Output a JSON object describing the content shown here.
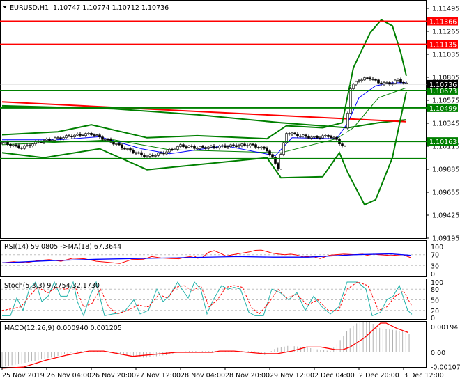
{
  "chart_data": [
    {
      "type": "candlestick",
      "title": "EURUSD,H1",
      "ohlc_text": "1.10747 1.10774 1.10712 1.10736",
      "ylim": [
        1.09195,
        1.11495
      ],
      "y_ticks": [
        "1.11495",
        "1.11265",
        "1.11035",
        "1.10805",
        "1.10575",
        "1.10345",
        "1.10115",
        "1.09885",
        "1.09655",
        "1.09425",
        "1.09195"
      ],
      "current_price": "1.10736",
      "levels": [
        {
          "value": 1.11366,
          "label": "1.11366",
          "color": "#ff0000"
        },
        {
          "value": 1.11135,
          "label": "1.11135",
          "color": "#ff0000"
        },
        {
          "value": 1.10673,
          "label": "1.10673",
          "color": "#008000"
        },
        {
          "value": 1.10499,
          "label": "1.10499",
          "color": "#008000"
        },
        {
          "value": 1.10163,
          "label": "1.10163",
          "color": "#008000"
        },
        {
          "value": 1.0999,
          "label": "",
          "color": "#008000"
        }
      ],
      "close": [
        [
          0,
          1.1015
        ],
        [
          7,
          1.101
        ],
        [
          13,
          1.1016
        ],
        [
          19,
          1.1019
        ],
        [
          25,
          1.1022
        ],
        [
          32,
          1.1024
        ],
        [
          39,
          1.1016
        ],
        [
          45,
          1.1008
        ],
        [
          52,
          1.1001
        ],
        [
          58,
          1.1005
        ],
        [
          64,
          1.1012
        ],
        [
          70,
          1.101
        ],
        [
          77,
          1.1011
        ],
        [
          83,
          1.1012
        ],
        [
          89,
          1.1013
        ],
        [
          95,
          1.1008
        ],
        [
          99,
          1.099
        ],
        [
          100,
          1.1003
        ],
        [
          102,
          1.1025
        ],
        [
          107,
          1.1022
        ],
        [
          112,
          1.102
        ],
        [
          117,
          1.1022
        ],
        [
          120,
          1.1018
        ],
        [
          122,
          1.1012
        ],
        [
          124,
          1.1045
        ],
        [
          125,
          1.107
        ],
        [
          128,
          1.1078
        ],
        [
          132,
          1.108
        ],
        [
          135,
          1.1075
        ],
        [
          139,
          1.1074
        ],
        [
          142,
          1.1078
        ],
        [
          145,
          1.10736
        ]
      ],
      "bb_upper": [
        [
          0,
          1.1023
        ],
        [
          20,
          1.1026
        ],
        [
          32,
          1.1033
        ],
        [
          52,
          1.102
        ],
        [
          70,
          1.1022
        ],
        [
          95,
          1.1019
        ],
        [
          102,
          1.1032
        ],
        [
          115,
          1.103
        ],
        [
          122,
          1.1035
        ],
        [
          126,
          1.109
        ],
        [
          132,
          1.1125
        ],
        [
          136,
          1.1138
        ],
        [
          140,
          1.1132
        ],
        [
          143,
          1.1105
        ],
        [
          145,
          1.1082
        ]
      ],
      "bb_lower": [
        [
          0,
          1.1005
        ],
        [
          15,
          1.1
        ],
        [
          35,
          1.1009
        ],
        [
          52,
          1.0988
        ],
        [
          70,
          1.0993
        ],
        [
          95,
          1.1
        ],
        [
          100,
          1.098
        ],
        [
          115,
          1.0981
        ],
        [
          121,
          1.1005
        ],
        [
          124,
          1.0985
        ],
        [
          130,
          1.0953
        ],
        [
          134,
          1.0958
        ],
        [
          140,
          1.1
        ],
        [
          143,
          1.104
        ],
        [
          145,
          1.1066
        ]
      ],
      "ma_long": [
        [
          0,
          1.1052
        ],
        [
          40,
          1.1049
        ],
        [
          70,
          1.1043
        ],
        [
          100,
          1.1035
        ],
        [
          124,
          1.103
        ],
        [
          135,
          1.1035
        ],
        [
          145,
          1.1038
        ]
      ],
      "ma_trend": [
        [
          0,
          1.1056
        ],
        [
          145,
          1.1036
        ]
      ],
      "ma_mid": [
        [
          0,
          1.1013
        ],
        [
          40,
          1.1018
        ],
        [
          60,
          1.1008
        ],
        [
          100,
          1.1005
        ],
        [
          120,
          1.1019
        ],
        [
          126,
          1.103
        ],
        [
          135,
          1.106
        ],
        [
          145,
          1.107
        ]
      ],
      "ma_fast": [
        [
          0,
          1.1018
        ],
        [
          20,
          1.1018
        ],
        [
          35,
          1.1021
        ],
        [
          50,
          1.1009
        ],
        [
          60,
          1.1004
        ],
        [
          80,
          1.1012
        ],
        [
          98,
          1.1002
        ],
        [
          104,
          1.102
        ],
        [
          120,
          1.1019
        ],
        [
          124,
          1.1035
        ],
        [
          128,
          1.106
        ],
        [
          134,
          1.1072
        ],
        [
          140,
          1.1075
        ],
        [
          145,
          1.1075
        ]
      ]
    },
    {
      "type": "line",
      "title": "RSI(14) 59.0805  ->MA(18) 67.3644",
      "ylim": [
        0,
        100
      ],
      "y_ticks": [
        "100",
        "70",
        "30",
        "0"
      ],
      "rsi": [
        [
          0,
          40
        ],
        [
          10,
          44
        ],
        [
          20,
          40
        ],
        [
          30,
          48
        ],
        [
          40,
          52
        ],
        [
          50,
          46
        ],
        [
          60,
          57
        ],
        [
          70,
          55
        ],
        [
          80,
          46
        ],
        [
          90,
          42
        ],
        [
          100,
          38
        ],
        [
          110,
          52
        ],
        [
          120,
          53
        ],
        [
          127,
          63
        ],
        [
          135,
          58
        ],
        [
          143,
          56
        ],
        [
          150,
          55
        ],
        [
          155,
          60
        ],
        [
          160,
          63
        ],
        [
          163,
          66
        ],
        [
          166,
          57
        ],
        [
          170,
          60
        ],
        [
          175,
          78
        ],
        [
          180,
          85
        ],
        [
          185,
          76
        ],
        [
          190,
          65
        ],
        [
          200,
          73
        ],
        [
          210,
          80
        ],
        [
          215,
          86
        ],
        [
          220,
          87
        ],
        [
          225,
          81
        ],
        [
          230,
          75
        ],
        [
          235,
          72
        ],
        [
          240,
          70
        ],
        [
          245,
          72
        ],
        [
          250,
          69
        ],
        [
          256,
          62
        ],
        [
          262,
          65
        ],
        [
          270,
          56
        ],
        [
          278,
          68
        ],
        [
          283,
          70
        ],
        [
          290,
          72
        ],
        [
          300,
          70
        ],
        [
          306,
          72
        ],
        [
          310,
          68
        ],
        [
          315,
          72
        ],
        [
          320,
          70
        ],
        [
          330,
          67
        ],
        [
          340,
          70
        ],
        [
          347,
          59
        ]
      ],
      "rsi_ma": [
        [
          0,
          40
        ],
        [
          40,
          48
        ],
        [
          80,
          53
        ],
        [
          140,
          58
        ],
        [
          200,
          63
        ],
        [
          230,
          61
        ],
        [
          260,
          61
        ],
        [
          300,
          70
        ],
        [
          330,
          73
        ],
        [
          347,
          67.4
        ]
      ]
    },
    {
      "type": "line",
      "title": "Stoch(5,3,3) 9.2754 32.1730",
      "ylim": [
        0,
        100
      ],
      "y_ticks": [
        "100",
        "80",
        "50",
        "20",
        "0"
      ],
      "main": [
        [
          0,
          5
        ],
        [
          8,
          5
        ],
        [
          14,
          55
        ],
        [
          20,
          20
        ],
        [
          26,
          80
        ],
        [
          32,
          100
        ],
        [
          38,
          45
        ],
        [
          44,
          60
        ],
        [
          50,
          100
        ],
        [
          56,
          60
        ],
        [
          62,
          60
        ],
        [
          68,
          100
        ],
        [
          72,
          45
        ],
        [
          78,
          5
        ],
        [
          84,
          60
        ],
        [
          90,
          100
        ],
        [
          98,
          5
        ],
        [
          106,
          10
        ],
        [
          112,
          12
        ],
        [
          118,
          20
        ],
        [
          126,
          50
        ],
        [
          132,
          10
        ],
        [
          140,
          20
        ],
        [
          148,
          80
        ],
        [
          154,
          45
        ],
        [
          160,
          60
        ],
        [
          168,
          100
        ],
        [
          172,
          80
        ],
        [
          178,
          55
        ],
        [
          184,
          100
        ],
        [
          190,
          80
        ],
        [
          196,
          10
        ],
        [
          202,
          50
        ],
        [
          210,
          90
        ],
        [
          216,
          80
        ],
        [
          222,
          85
        ],
        [
          228,
          80
        ],
        [
          236,
          15
        ],
        [
          242,
          5
        ],
        [
          250,
          5
        ],
        [
          258,
          80
        ],
        [
          266,
          70
        ],
        [
          274,
          50
        ],
        [
          282,
          70
        ],
        [
          290,
          20
        ],
        [
          298,
          60
        ],
        [
          306,
          30
        ],
        [
          314,
          10
        ],
        [
          322,
          30
        ],
        [
          330,
          100
        ],
        [
          340,
          100
        ],
        [
          348,
          80
        ],
        [
          354,
          5
        ],
        [
          362,
          15
        ],
        [
          368,
          50
        ],
        [
          374,
          60
        ],
        [
          380,
          90
        ],
        [
          388,
          20
        ],
        [
          392,
          9
        ]
      ],
      "signal": [
        [
          0,
          20
        ],
        [
          10,
          25
        ],
        [
          18,
          30
        ],
        [
          26,
          60
        ],
        [
          34,
          85
        ],
        [
          44,
          70
        ],
        [
          52,
          85
        ],
        [
          60,
          80
        ],
        [
          70,
          85
        ],
        [
          78,
          30
        ],
        [
          86,
          40
        ],
        [
          94,
          80
        ],
        [
          102,
          30
        ],
        [
          110,
          10
        ],
        [
          120,
          20
        ],
        [
          130,
          35
        ],
        [
          140,
          30
        ],
        [
          150,
          65
        ],
        [
          158,
          55
        ],
        [
          166,
          85
        ],
        [
          174,
          90
        ],
        [
          182,
          75
        ],
        [
          190,
          90
        ],
        [
          198,
          30
        ],
        [
          206,
          50
        ],
        [
          214,
          85
        ],
        [
          222,
          90
        ],
        [
          230,
          85
        ],
        [
          238,
          30
        ],
        [
          246,
          10
        ],
        [
          256,
          45
        ],
        [
          264,
          80
        ],
        [
          272,
          55
        ],
        [
          282,
          65
        ],
        [
          292,
          35
        ],
        [
          302,
          50
        ],
        [
          312,
          20
        ],
        [
          322,
          20
        ],
        [
          330,
          80
        ],
        [
          340,
          100
        ],
        [
          350,
          90
        ],
        [
          360,
          20
        ],
        [
          368,
          30
        ],
        [
          376,
          60
        ],
        [
          384,
          75
        ],
        [
          392,
          32
        ]
      ]
    },
    {
      "type": "bar+line",
      "title": "MACD(12,26,9) 0.000940 0.001205",
      "ylim": [
        -0.001076,
        0.00194
      ],
      "y_ticks": [
        "0.00194",
        "0.00",
        "-0.001076"
      ],
      "histogram_env": [
        [
          0,
          -0.0011
        ],
        [
          20,
          -0.0008
        ],
        [
          50,
          -0.0003
        ],
        [
          70,
          0.0001
        ],
        [
          90,
          0.0001
        ],
        [
          110,
          -0.0002
        ],
        [
          130,
          -0.0004
        ],
        [
          150,
          -0.0002
        ],
        [
          170,
          0.0001
        ],
        [
          190,
          0.0001
        ],
        [
          210,
          0.0001
        ],
        [
          230,
          0.0001
        ],
        [
          240,
          -0.0002
        ],
        [
          250,
          0.0003
        ],
        [
          262,
          0.0005
        ],
        [
          276,
          0.0004
        ],
        [
          290,
          0.0002
        ],
        [
          300,
          0.0001
        ],
        [
          306,
          0.0006
        ],
        [
          316,
          0.0017
        ],
        [
          326,
          0.0023
        ],
        [
          336,
          0.0023
        ],
        [
          346,
          0.0018
        ],
        [
          356,
          0.0017
        ],
        [
          366,
          0.0016
        ],
        [
          372,
          0.0014
        ]
      ],
      "signal": [
        [
          0,
          -0.0012
        ],
        [
          30,
          -0.0011
        ],
        [
          60,
          -0.0006
        ],
        [
          90,
          -0.0002
        ],
        [
          120,
          0.0001
        ],
        [
          140,
          0.0001
        ],
        [
          160,
          -0.0001
        ],
        [
          180,
          -0.0003
        ],
        [
          200,
          -0.0002
        ],
        [
          240,
          0.0
        ],
        [
          290,
          0.0
        ],
        [
          300,
          0.0001
        ],
        [
          320,
          0.0001
        ],
        [
          340,
          0.0
        ],
        [
          360,
          -0.0001
        ],
        [
          380,
          -0.0001
        ],
        [
          400,
          0.0001
        ],
        [
          420,
          0.0004
        ],
        [
          440,
          0.0004
        ],
        [
          460,
          0.0002
        ],
        [
          470,
          0.0002
        ],
        [
          480,
          0.0004
        ],
        [
          500,
          0.0011
        ],
        [
          510,
          0.0016
        ],
        [
          522,
          0.0022
        ],
        [
          530,
          0.0022
        ],
        [
          545,
          0.0018
        ],
        [
          555,
          0.0016
        ],
        [
          560,
          0.0015
        ]
      ]
    },
    {
      "type": "axis",
      "x_ticks": [
        "25 Nov 2019",
        "26 Nov 04:00",
        "26 Nov 20:00",
        "27 Nov 12:00",
        "28 Nov 04:00",
        "28 Nov 20:00",
        "29 Nov 12:00",
        "2 Dec 04:00",
        "2 Dec 20:00",
        "3 Dec 12:00"
      ]
    }
  ]
}
